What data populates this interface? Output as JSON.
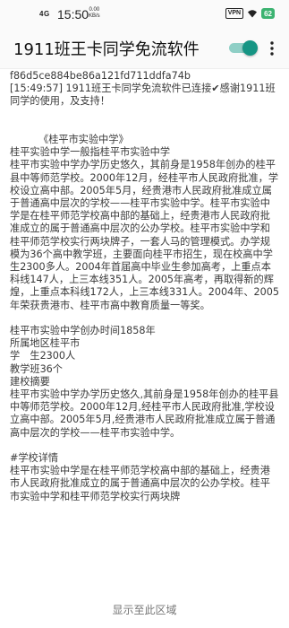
{
  "status_bar": {
    "signal": "4G",
    "time": "15:50",
    "net_speed": "0.00",
    "net_unit": "KB/s",
    "vpn": "VPN",
    "battery": "62"
  },
  "app_bar": {
    "title": "1911班王卡同学免流软件",
    "toggle_on": true
  },
  "log": {
    "hash": "f86d5ce884be86a121fd711ddfa74b",
    "connected": "[15:49:57] 1911班王卡同学免流软件已连接✔感谢1911班同学的使用，及支持！"
  },
  "article": {
    "heading": "《桂平市实验中学》",
    "subheading": "桂平实验中学一般指桂平市实验中学",
    "para1": "桂平市实验中学办学历史悠久，其前身是1958年创办的桂平县中等师范学校。2000年12月，经桂平市人民政府批准，学校设立高中部。2005年5月，经贵港市人民政府批准成立属于普通高中层次的学校——桂平市实验中学。桂平市实验中学是在桂平师范学校高中部的基础上，经贵港市人民政府批准成立的属于普通高中层次的公办学校。桂平市实验中学和桂平师范学校实行两块牌子，一套人马的管理模式。办学规模为36个高中教学班，主要面向桂平市招生，现在校高中学生2300多人。2004年首届高中毕业生参加高考，上重点本科线147人，上三本线351人。2005年高考，再取得新的辉煌，上重点本科线172人，上三本线331人。2004年、2005年荣获贵港市、桂平市高中教育质量一等奖。",
    "founded": "桂平市实验中学创办时间1858年",
    "region": "所属地区桂平市",
    "students": "学　生2300人",
    "classes": "教学班36个",
    "summary_heading": "建校摘要",
    "summary": "桂平市实验中学办学历史悠久,其前身是1958年创办的桂平县中等师范学校。2000年12月,经桂平市人民政府批准,学校设立高中部。2005年5月,经贵港市人民政府批准成立属于普通高中层次的学校——桂平市实验中学。",
    "details_heading": "#学校详情",
    "details": "桂平市实验中学是在桂平师范学校高中部的基础上，经贵港市人民政府批准成立的属于普通高中层次的公办学校。桂平市实验中学和桂平师范学校实行两块牌"
  },
  "footer": {
    "label": "显示至此区域"
  },
  "colors": {
    "toggle_thumb": "#169584",
    "toggle_track": "#8fcfc6",
    "battery": "#3cb371"
  }
}
